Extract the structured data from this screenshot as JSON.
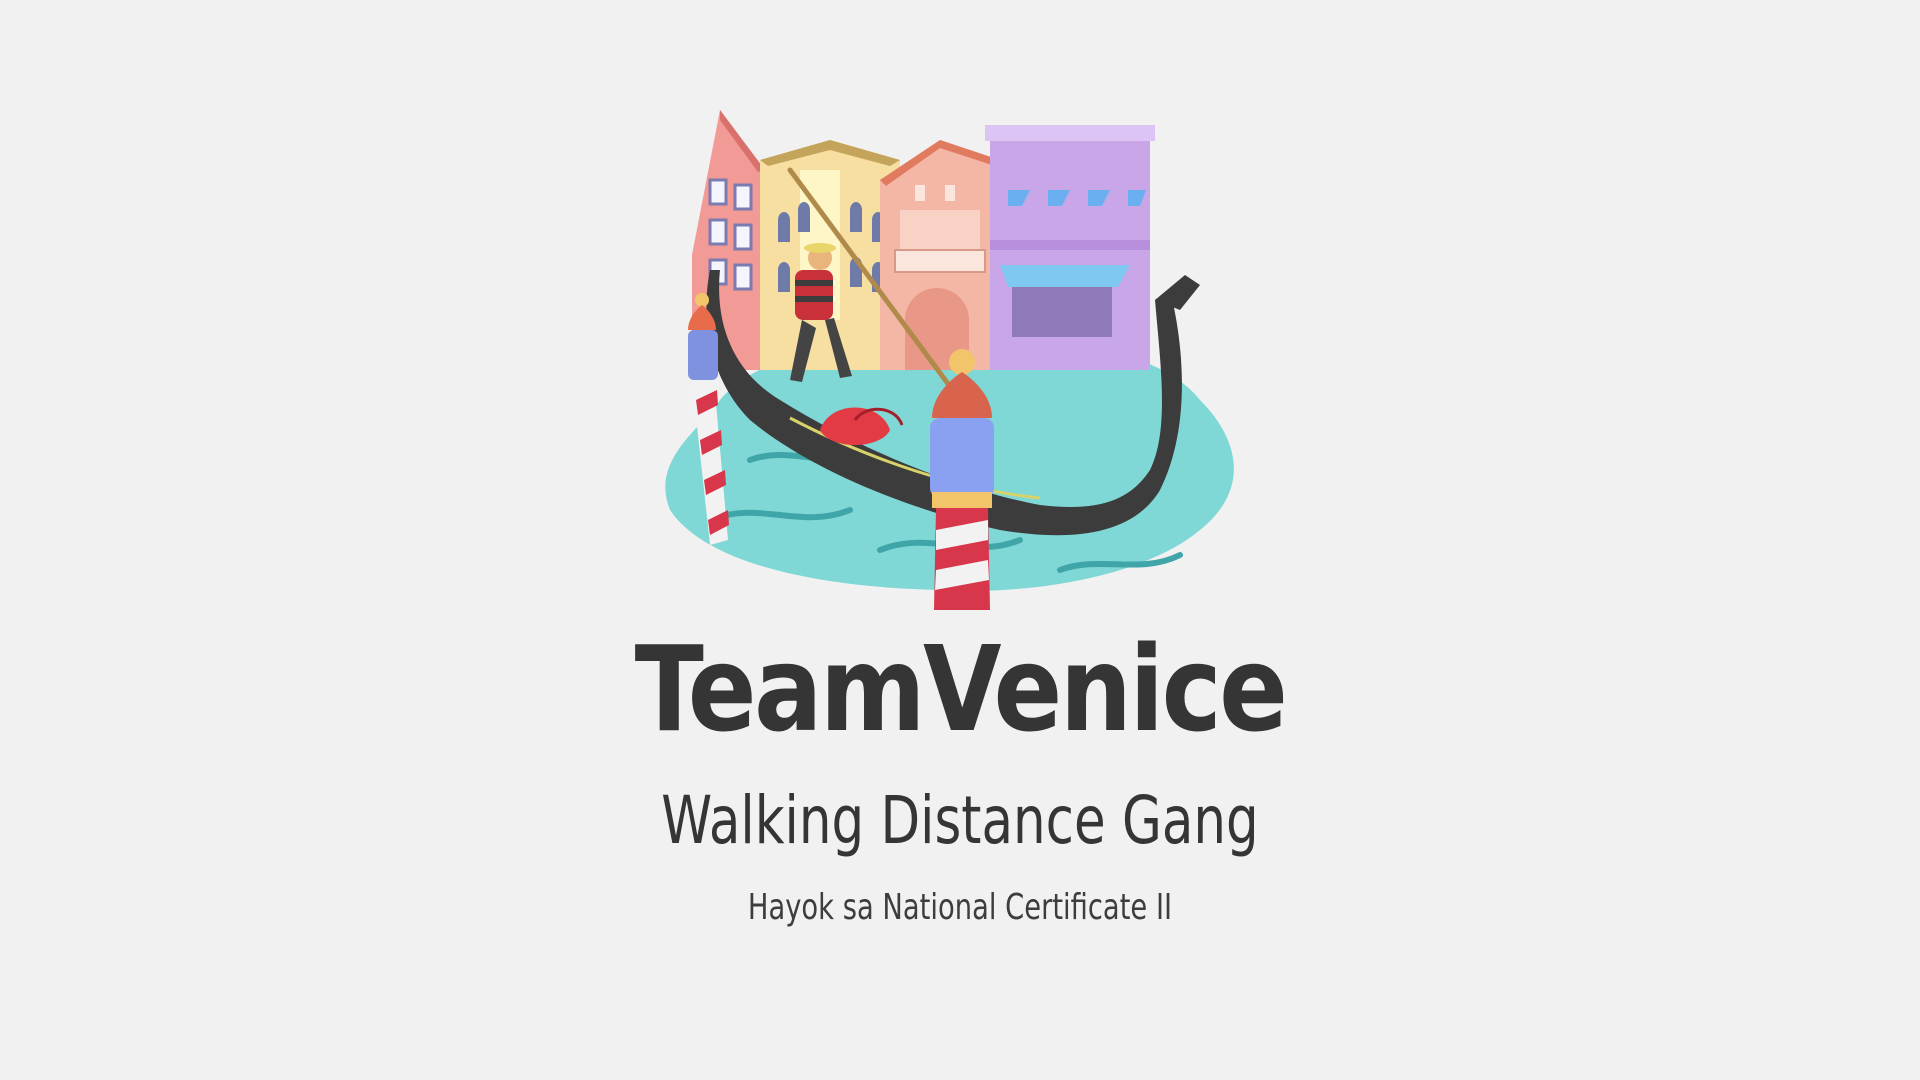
{
  "slide": {
    "title": "TeamVenice",
    "subtitle": "Walking Distance Gang",
    "caption": "Hayok sa National Certificate II"
  },
  "illustration": {
    "icon": "venice-gondola-illustration",
    "colors": {
      "background": "#f1f1f1",
      "text": "#353535",
      "water": "#7fd8d5",
      "gondola": "#3c3c3c",
      "pink_house": "#f29a96",
      "yellow_house": "#f6dfa0",
      "salmon_house": "#f4b7a6",
      "purple_house": "#c9a6e8"
    }
  }
}
